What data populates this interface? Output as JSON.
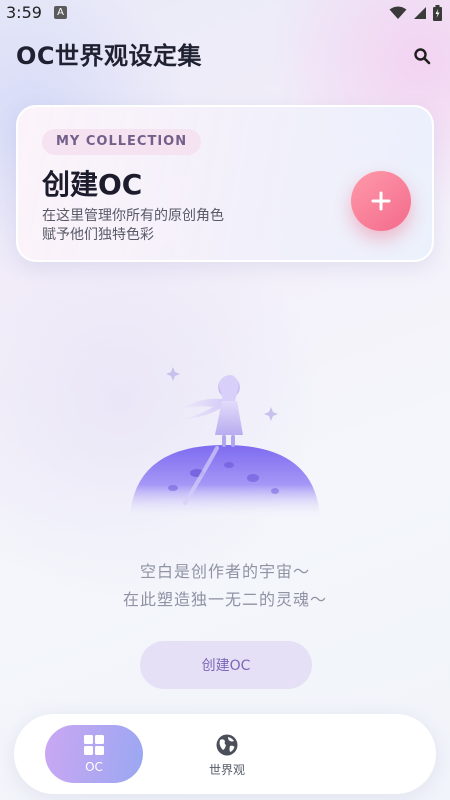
{
  "status_bar": {
    "time": "3:59",
    "notification_letter": "A"
  },
  "header": {
    "title": "OC世界观设定集",
    "search_icon": "search-icon"
  },
  "card": {
    "badge": "MY COLLECTION",
    "title": "创建OC",
    "desc_line1": "在这里管理你所有的原创角色",
    "desc_line2": "赋予他们独特色彩",
    "add_icon": "plus-icon"
  },
  "empty_state": {
    "line1": "空白是创作者的宇宙～",
    "line2": "在此塑造独一无二的灵魂～",
    "button_label": "创建OC"
  },
  "tabs": [
    {
      "label": "OC",
      "icon": "grid-icon",
      "active": true
    },
    {
      "label": "世界观",
      "icon": "globe-icon",
      "active": false
    }
  ],
  "colors": {
    "accent_pink": "#f36a8b",
    "accent_purple": "#9a8af0",
    "title_text": "#1f2030"
  }
}
